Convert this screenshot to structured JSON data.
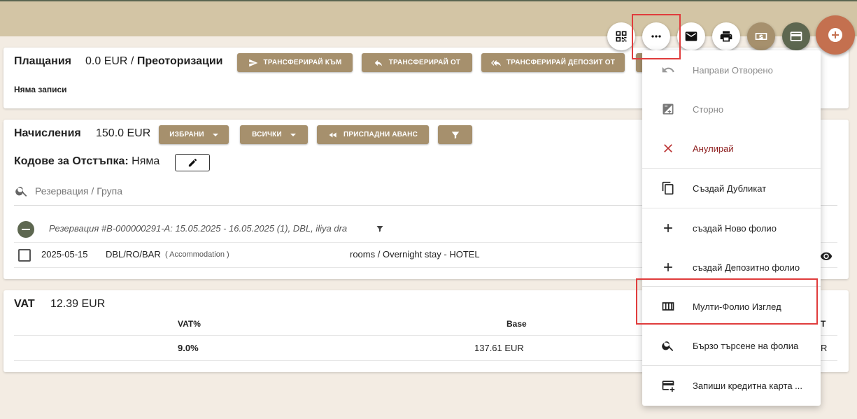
{
  "payments": {
    "title": "Плащания",
    "amount": "0.0 EUR / ",
    "preauth": "Преоторизации",
    "buttons": [
      "ТРАНСФЕРИРАЙ КЪМ",
      "ТРАНСФЕРИРАЙ ОТ",
      "ТРАНСФЕРИРАЙ ДЕПОЗИТ ОТ"
    ],
    "empty": "Няма записи"
  },
  "charges": {
    "title": "Начисления",
    "amount": "150.0 EUR",
    "selected_label": "ИЗБРАНИ",
    "all_label": "ВСИЧКИ",
    "deduct_label": "ПРИСПАДНИ АВАНС",
    "discount_label": "Кодове за Отстъпка:",
    "discount_value": "Няма",
    "search_placeholder": "Резервация / Група",
    "group_header": "Резервация #B-000000291-A: 15.05.2025 - 16.05.2025 (1), DBL, iliya dra",
    "row": {
      "date": "2025-05-15",
      "code": "DBL/RO/BAR",
      "type": "( Accommodation )",
      "desc": "rooms / Overnight stay - HOTEL"
    }
  },
  "vat": {
    "title": "VAT",
    "amount": "12.39 EUR",
    "headers": [
      "VAT%",
      "Base",
      "T"
    ],
    "rows": [
      [
        "9.0%",
        "137.61 EUR",
        "R"
      ]
    ]
  },
  "menu": {
    "items": [
      {
        "label": "Направи Отворено",
        "icon": "undo-icon",
        "state": "disabled"
      },
      {
        "label": "Сторно",
        "icon": "storno-icon",
        "state": "disabled"
      },
      {
        "label": "Анулирай",
        "icon": "close-icon",
        "state": "warn"
      },
      {
        "label": "Създай Дубликат",
        "icon": "copy-icon",
        "state": "normal"
      },
      {
        "label": "създай Ново фолио",
        "icon": "plus-icon",
        "state": "normal"
      },
      {
        "label": "създай Депозитно фолио",
        "icon": "plus-icon",
        "state": "normal"
      },
      {
        "label": "Мулти-Фолио Изглед",
        "icon": "columns-icon",
        "state": "normal"
      },
      {
        "label": "Бързо търсене на фолиа",
        "icon": "search-icon",
        "state": "normal"
      },
      {
        "label": "Запиши кредитна карта ...",
        "icon": "card-add-icon",
        "state": "normal"
      }
    ]
  },
  "colors": {
    "accent": "#a6906d",
    "topbar": "#d3c5a5",
    "fab_primary": "#c4704f",
    "highlight": "#e03c3c",
    "danger": "#8b1a1a"
  }
}
